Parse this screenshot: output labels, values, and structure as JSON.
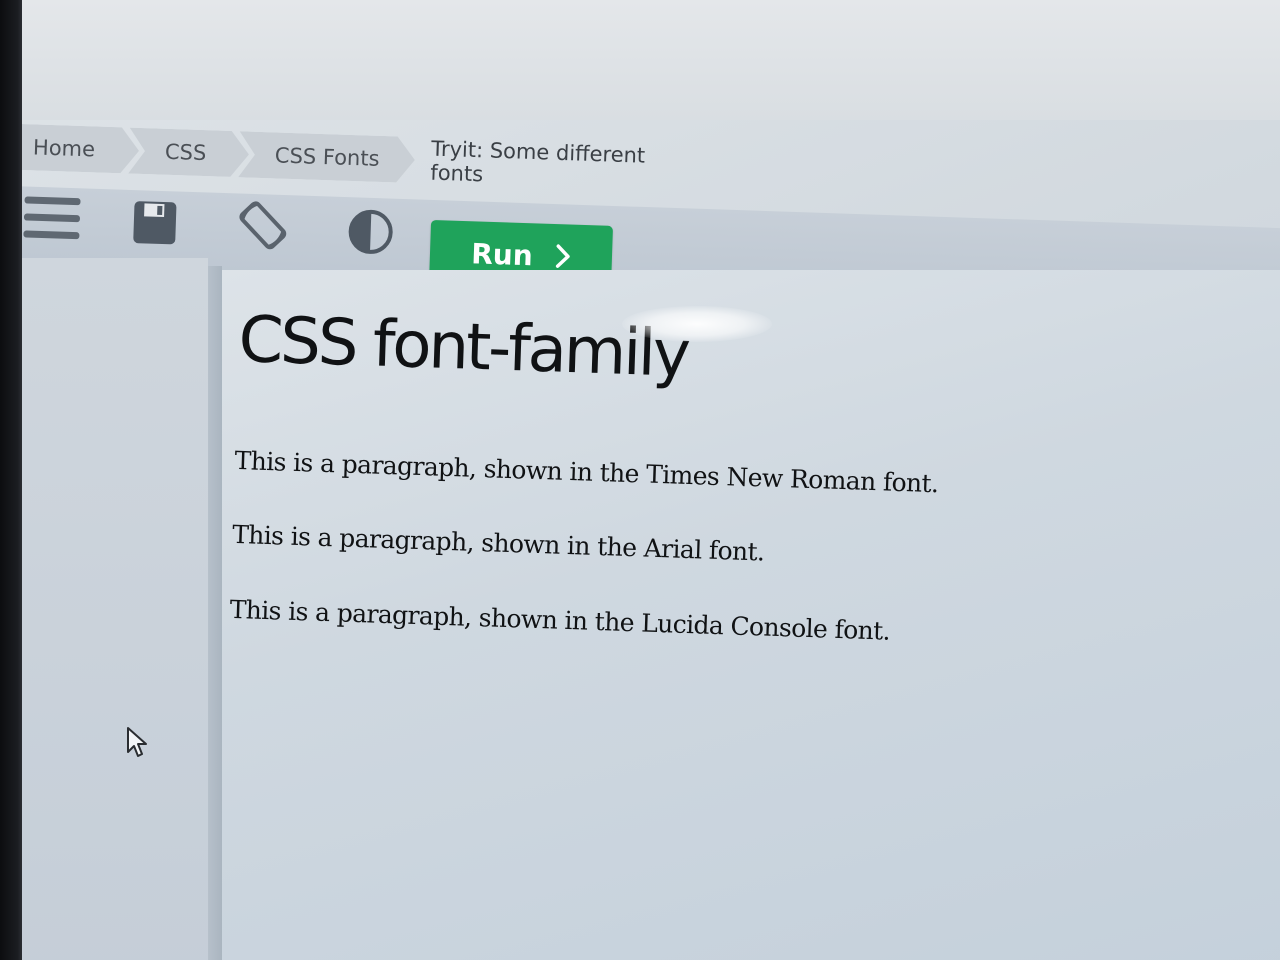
{
  "breadcrumb": {
    "items": [
      "Home",
      "CSS",
      "CSS Fonts"
    ],
    "current": "Tryit: Some different fonts"
  },
  "toolbar": {
    "run_label": "Run",
    "icons": [
      "menu-icon",
      "save-icon",
      "rotate-icon",
      "contrast-icon",
      "chevron-right-icon"
    ],
    "run_color": "#1fa35b"
  },
  "result": {
    "heading": "CSS font-family",
    "paragraphs": [
      "This is a paragraph, shown in the Times New Roman font.",
      "This is a paragraph, shown in the Arial font.",
      "This is a paragraph, shown in the Lucida Console font."
    ]
  }
}
